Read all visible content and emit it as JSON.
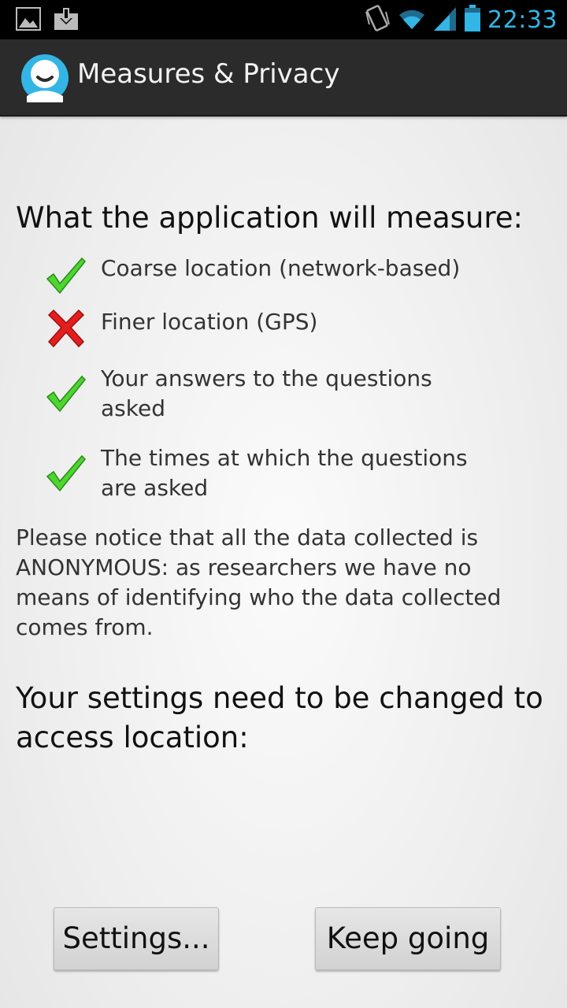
{
  "status_bar": {
    "time": "22:33",
    "left_icons": [
      "image-icon",
      "download-icon"
    ],
    "right_icons": [
      "vibrate-icon",
      "wifi-icon",
      "signal-icon",
      "battery-icon"
    ],
    "accent_color": "#33b5e5"
  },
  "action_bar": {
    "title": "Measures & Privacy",
    "logo_icon": "app-logo-icon"
  },
  "main": {
    "measure_heading": "What the application will measure:",
    "items": [
      {
        "text": "Coarse location (network-based)",
        "status": "check"
      },
      {
        "text": "Finer location (GPS)",
        "status": "cross"
      },
      {
        "text": "Your answers to the questions asked",
        "status": "check"
      },
      {
        "text": "The times at which the questions are asked",
        "status": "check"
      }
    ],
    "notice": "Please notice that all the data collected is ANONYMOUS: as researchers we have no means of identifying who the data collected comes from.",
    "settings_heading": "Your settings need to be changed to access location:"
  },
  "buttons": {
    "settings": "Settings...",
    "keep_going": "Keep going"
  }
}
